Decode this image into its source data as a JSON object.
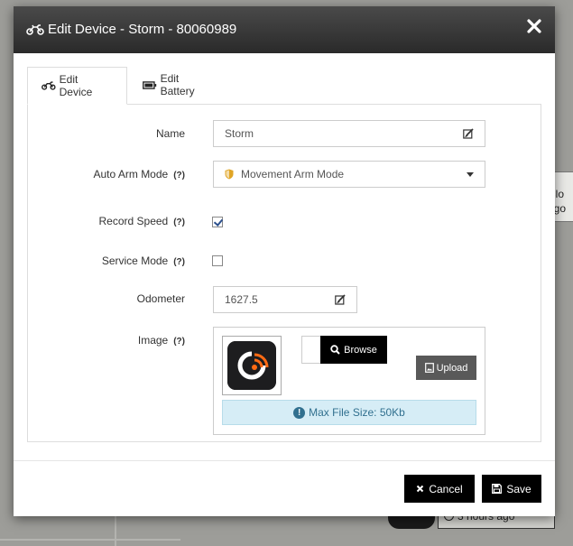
{
  "background": {
    "card_text_1": "Clo",
    "card_text_2": "ago",
    "time_text": "3 hours ago"
  },
  "modal": {
    "title": "Edit Device - Storm - 80060989",
    "tabs": [
      {
        "label": "Edit Device",
        "active": true,
        "icon": "motorcycle-icon"
      },
      {
        "label": "Edit Battery",
        "active": false,
        "icon": "battery-icon"
      }
    ],
    "form": {
      "name": {
        "label": "Name",
        "value": "Storm"
      },
      "auto_arm": {
        "label": "Auto Arm Mode",
        "help": "(?)",
        "value": "Movement Arm Mode"
      },
      "record_speed": {
        "label": "Record Speed",
        "help": "(?)",
        "checked": true
      },
      "service_mode": {
        "label": "Service Mode",
        "help": "(?)",
        "checked": false
      },
      "odometer": {
        "label": "Odometer",
        "value": "1627.5"
      },
      "image": {
        "label": "Image",
        "help": "(?)",
        "browse_label": "Browse",
        "upload_label": "Upload",
        "max_size_text": "Max File Size: 50Kb"
      }
    },
    "footer": {
      "cancel_label": "Cancel",
      "save_label": "Save"
    }
  },
  "colors": {
    "header_bg": "#333333",
    "info_bg": "#d6edf6",
    "info_text": "#31708f",
    "shield": "#e0a526",
    "logo_accent": "#ff6a13"
  }
}
